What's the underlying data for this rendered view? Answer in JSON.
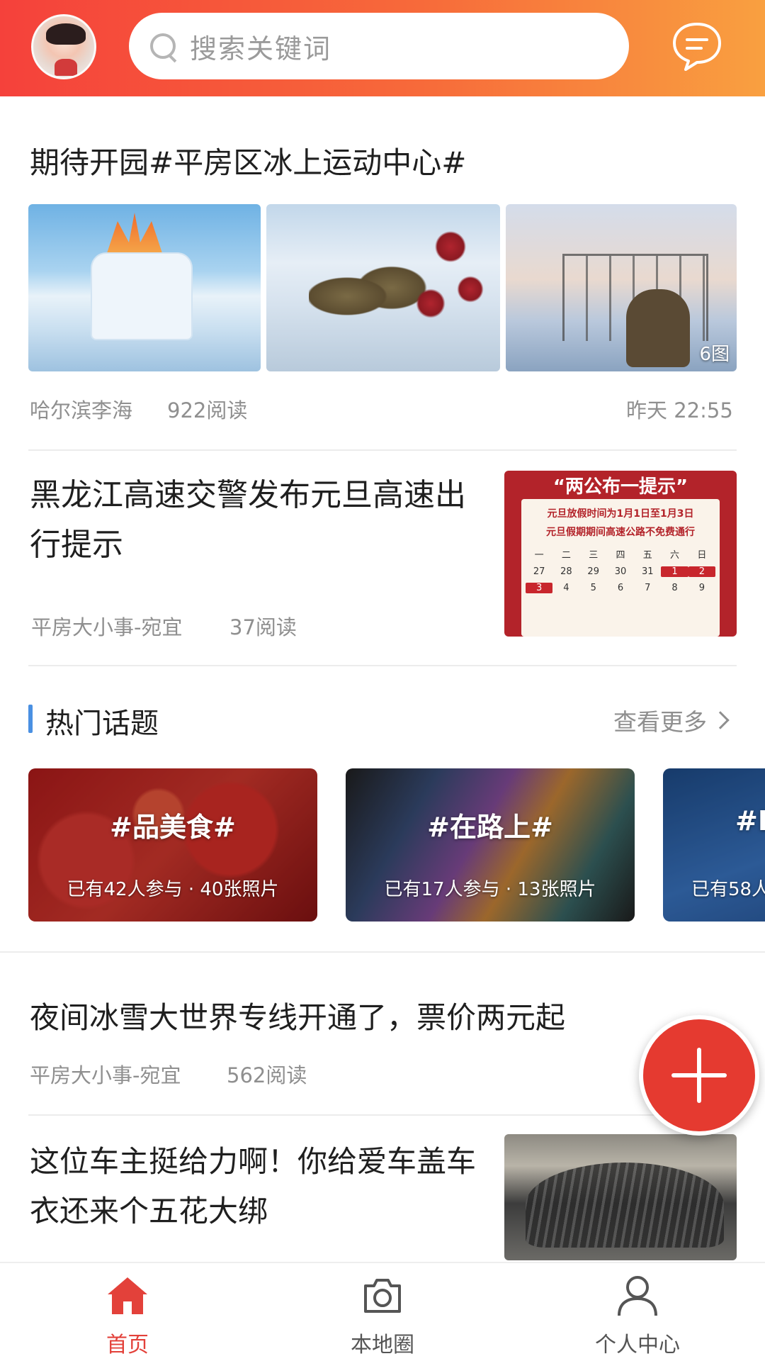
{
  "header": {
    "search_placeholder": "搜索关键词"
  },
  "feed": {
    "article1": {
      "title": "期待开园#平房区冰上运动中心#",
      "image_count": "6图",
      "author": "哈尔滨李海",
      "reads": "922阅读",
      "time": "昨天 22:55"
    },
    "article2": {
      "title": "黑龙江高速交警发布元旦高速出行提示",
      "author": "平房大小事-宛宜",
      "reads": "37阅读",
      "thumb_head": "“两公布一提示”",
      "thumb_line1": "元旦放假时间为1月1日至1月3日",
      "thumb_line2": "元旦假期期间高速公路不免费通行",
      "calendar": [
        "一",
        "二",
        "三",
        "四",
        "五",
        "六",
        "日",
        "27",
        "28",
        "29",
        "30",
        "31",
        "1",
        "2",
        "3",
        "4",
        "5",
        "6",
        "7",
        "8",
        "9"
      ]
    },
    "article3": {
      "title": "夜间冰雪大世界专线开通了，票价两元起",
      "author": "平房大小事-宛宜",
      "reads": "562阅读"
    },
    "article4": {
      "title": "这位车主挺给力啊！你给爱车盖车衣还来个五花大绑"
    }
  },
  "hot_topics": {
    "title": "热门话题",
    "more_label": "查看更多",
    "items": [
      {
        "name": "#品美食#",
        "stats": "已有42人参与 · 40张照片"
      },
      {
        "name": "#在路上#",
        "stats": "已有17人参与 · 13张照片"
      },
      {
        "name": "#Щ",
        "stats": "已有58人"
      }
    ]
  },
  "bottom_nav": {
    "home": "首页",
    "local_circle": "本地圈",
    "profile": "个人中心"
  },
  "colors": {
    "accent": "#e3413a",
    "header_start": "#f5413b",
    "header_end": "#f9a040",
    "section_bar": "#4a90e2"
  }
}
